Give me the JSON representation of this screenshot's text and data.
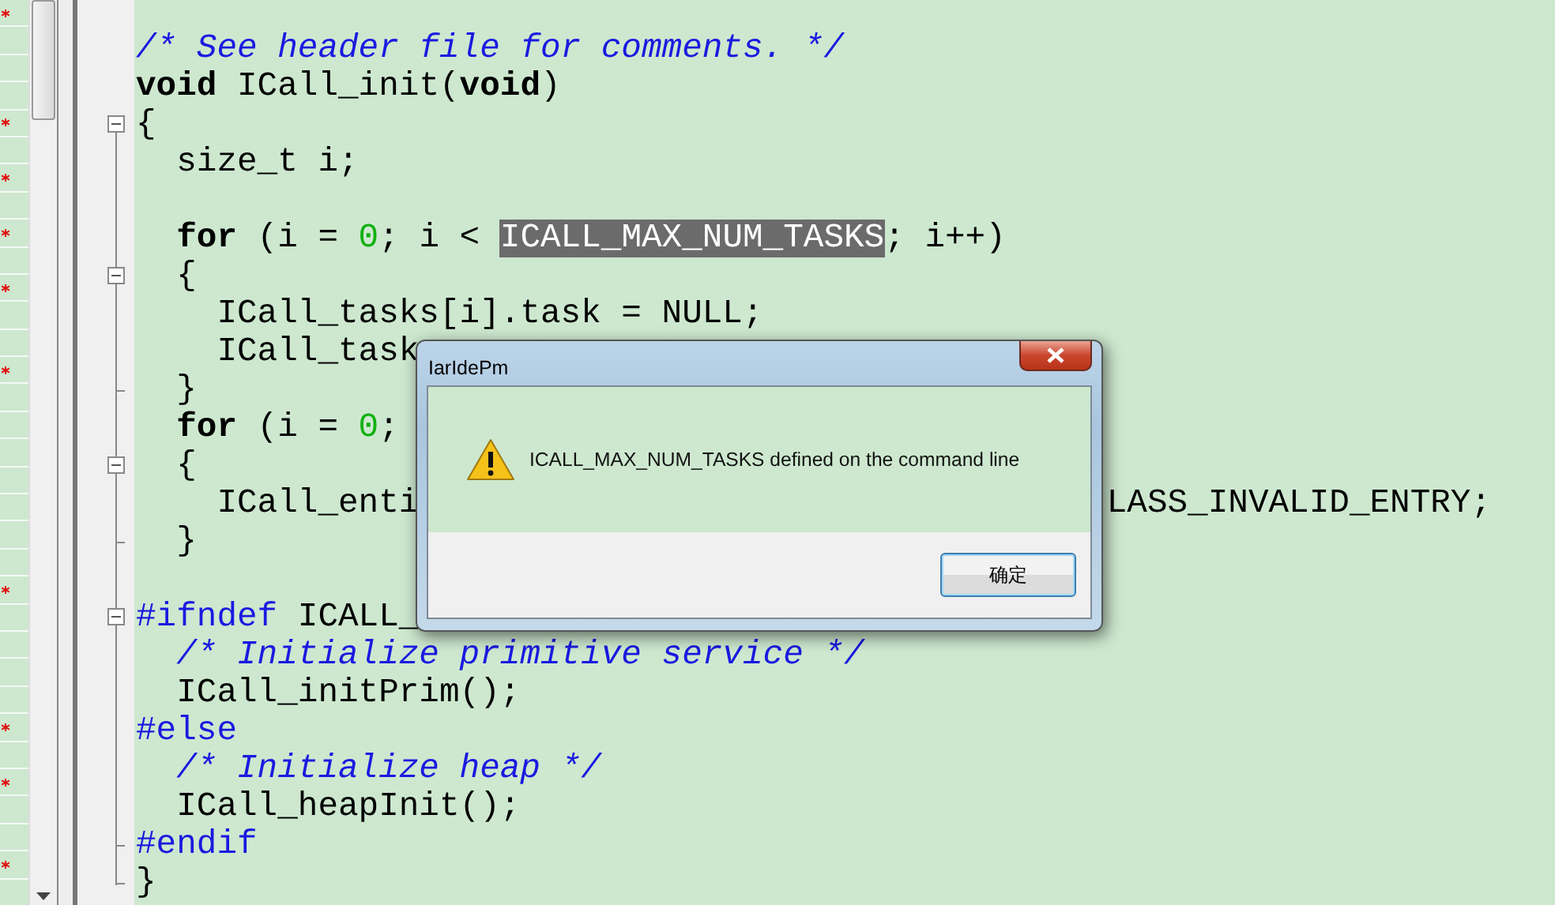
{
  "side_pane": {
    "rows": [
      {
        "modified": true
      },
      {
        "modified": false
      },
      {
        "modified": false
      },
      {
        "modified": false
      },
      {
        "modified": true
      },
      {
        "modified": false
      },
      {
        "modified": true
      },
      {
        "modified": false
      },
      {
        "modified": true
      },
      {
        "modified": false
      },
      {
        "modified": true
      },
      {
        "modified": false
      },
      {
        "modified": false
      },
      {
        "modified": true
      },
      {
        "modified": false
      },
      {
        "modified": false
      },
      {
        "modified": false
      },
      {
        "modified": false
      },
      {
        "modified": false
      },
      {
        "modified": false
      },
      {
        "modified": false
      },
      {
        "modified": true
      },
      {
        "modified": false
      },
      {
        "modified": false
      },
      {
        "modified": false
      },
      {
        "modified": false
      },
      {
        "modified": true
      },
      {
        "modified": false
      },
      {
        "modified": true
      },
      {
        "modified": false
      },
      {
        "modified": false
      },
      {
        "modified": true
      },
      {
        "modified": false
      }
    ]
  },
  "editor": {
    "lines": [
      {
        "fold_box": false,
        "fold_end": false
      },
      {
        "fold_box": false,
        "fold_end": false,
        "tokens": [
          {
            "kind": "comment",
            "text": "/* See header file for comments. */"
          }
        ]
      },
      {
        "fold_box": false,
        "fold_end": false,
        "tokens": [
          {
            "kind": "keyword",
            "text": "void"
          },
          {
            "kind": "plain",
            "text": " ICall_init("
          },
          {
            "kind": "keyword",
            "text": "void"
          },
          {
            "kind": "plain",
            "text": ")"
          }
        ]
      },
      {
        "fold_box": true,
        "fold_end": false,
        "tokens": [
          {
            "kind": "plain",
            "text": "{"
          }
        ]
      },
      {
        "fold_box": false,
        "fold_end": false,
        "tokens": [
          {
            "kind": "plain",
            "text": "  size_t i;"
          }
        ]
      },
      {
        "fold_box": false,
        "fold_end": false
      },
      {
        "fold_box": false,
        "fold_end": false,
        "tokens": [
          {
            "kind": "keyword",
            "text": "  for"
          },
          {
            "kind": "plain",
            "text": " (i = "
          },
          {
            "kind": "number",
            "text": "0"
          },
          {
            "kind": "plain",
            "text": "; i < "
          },
          {
            "kind": "selection",
            "text": "ICALL_MAX_NUM_TASKS"
          },
          {
            "kind": "plain",
            "text": "; i++)"
          }
        ]
      },
      {
        "fold_box": true,
        "fold_end": false,
        "tokens": [
          {
            "kind": "plain",
            "text": "  {"
          }
        ]
      },
      {
        "fold_box": false,
        "fold_end": false,
        "tokens": [
          {
            "kind": "plain",
            "text": "    ICall_tasks[i].task = NULL;"
          }
        ]
      },
      {
        "fold_box": false,
        "fold_end": false,
        "tokens": [
          {
            "kind": "plain",
            "text": "    ICall_task"
          }
        ]
      },
      {
        "fold_box": false,
        "fold_end": true,
        "tokens": [
          {
            "kind": "plain",
            "text": "  }"
          }
        ]
      },
      {
        "fold_box": false,
        "fold_end": false,
        "tokens": [
          {
            "kind": "keyword",
            "text": "  for"
          },
          {
            "kind": "plain",
            "text": " (i = "
          },
          {
            "kind": "number",
            "text": "0"
          },
          {
            "kind": "plain",
            "text": "; "
          }
        ]
      },
      {
        "fold_box": true,
        "fold_end": false,
        "tokens": [
          {
            "kind": "plain",
            "text": "  {"
          }
        ]
      },
      {
        "fold_box": false,
        "fold_end": false,
        "tokens": [
          {
            "kind": "plain",
            "text": "    ICall_enti                                  LASS_INVALID_ENTRY;"
          }
        ]
      },
      {
        "fold_box": false,
        "fold_end": true,
        "tokens": [
          {
            "kind": "plain",
            "text": "  }"
          }
        ]
      },
      {
        "fold_box": false,
        "fold_end": false
      },
      {
        "fold_box": true,
        "fold_end": false,
        "tokens": [
          {
            "kind": "preproc",
            "text": "#ifndef"
          },
          {
            "kind": "plain",
            "text": " ICALL_"
          }
        ]
      },
      {
        "fold_box": false,
        "fold_end": false,
        "tokens": [
          {
            "kind": "comment",
            "text": "  /* Initialize primitive service */"
          }
        ]
      },
      {
        "fold_box": false,
        "fold_end": false,
        "tokens": [
          {
            "kind": "plain",
            "text": "  ICall_initPrim();"
          }
        ]
      },
      {
        "fold_box": false,
        "fold_end": false,
        "tokens": [
          {
            "kind": "preproc",
            "text": "#else"
          }
        ]
      },
      {
        "fold_box": false,
        "fold_end": false,
        "tokens": [
          {
            "kind": "comment",
            "text": "  /* Initialize heap */"
          }
        ]
      },
      {
        "fold_box": false,
        "fold_end": false,
        "tokens": [
          {
            "kind": "plain",
            "text": "  ICall_heapInit();"
          }
        ]
      },
      {
        "fold_box": false,
        "fold_end": true,
        "tokens": [
          {
            "kind": "preproc",
            "text": "#endif"
          }
        ]
      },
      {
        "fold_box": false,
        "fold_end": true,
        "tokens": [
          {
            "kind": "plain",
            "text": "}"
          }
        ]
      }
    ]
  },
  "dialog": {
    "title": "IarIdePm",
    "message": "ICALL_MAX_NUM_TASKS defined on the command line",
    "buttons": [
      {
        "label": "确定",
        "default": true
      }
    ]
  }
}
